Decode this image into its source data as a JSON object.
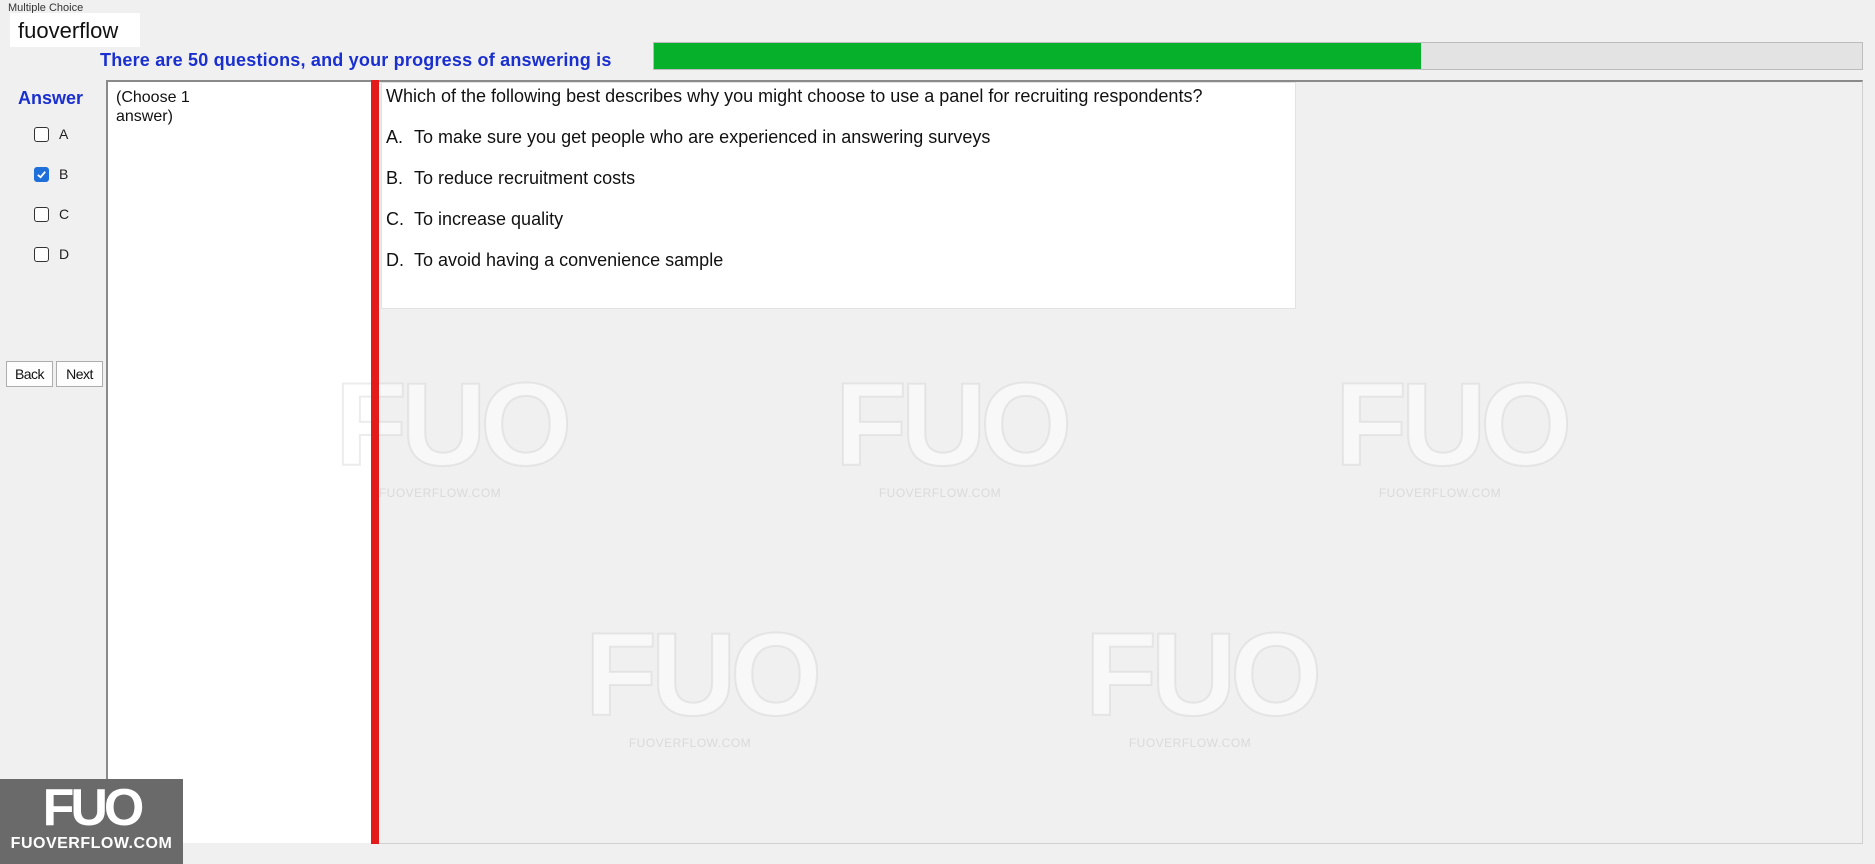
{
  "window": {
    "title": "Multiple Choice"
  },
  "logo_label": "fuoverflow",
  "progress": {
    "caption": "There are 50 questions, and your progress of answering is",
    "fraction": 0.635,
    "fill_color": "#06b02b"
  },
  "answer_panel": {
    "heading": "Answer",
    "options": [
      {
        "label": "A",
        "checked": false
      },
      {
        "label": "B",
        "checked": true
      },
      {
        "label": "C",
        "checked": false
      },
      {
        "label": "D",
        "checked": false
      }
    ]
  },
  "nav": {
    "back_label": "Back",
    "next_label": "Next"
  },
  "left_pane": {
    "hint": "(Choose 1 answer)"
  },
  "question": {
    "text": "Which of the following best describes why you might choose to use a panel for recruiting respondents?",
    "choices": [
      {
        "letter": "A.",
        "text": "To make sure you get people who are experienced in answering surveys"
      },
      {
        "letter": "B.",
        "text": "To reduce recruitment costs"
      },
      {
        "letter": "C.",
        "text": "To increase quality"
      },
      {
        "letter": "D.",
        "text": "To avoid having a convenience sample"
      }
    ]
  },
  "watermark": {
    "mark": "FUO",
    "site": "FUOVERFLOW.COM"
  },
  "corner_logo": {
    "mark": "FUO",
    "site": "FUOVERFLOW.COM"
  },
  "colors": {
    "accent_blue": "#1a2fcf",
    "divider_red": "#e31b1b",
    "checkbox_checked": "#1e6fd9"
  }
}
